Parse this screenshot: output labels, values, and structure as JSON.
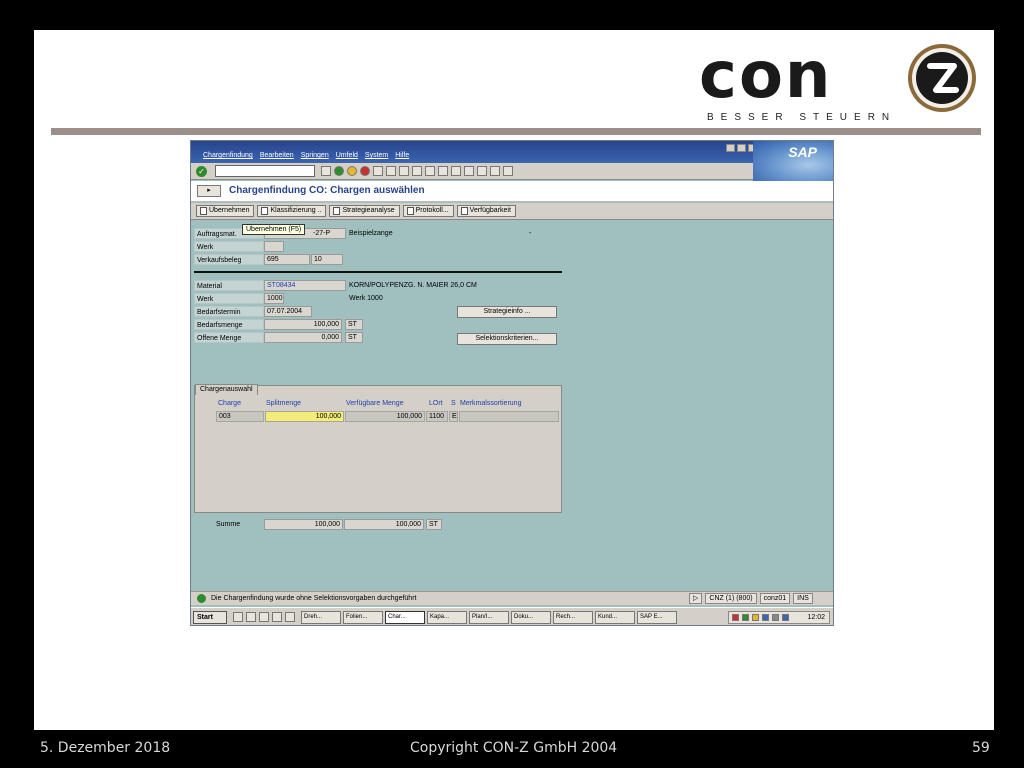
{
  "logo": {
    "word": "con",
    "tagline": "BESSER STEUERN"
  },
  "footer": {
    "date": "5. Dezember 2018",
    "copyright": "Copyright CON-Z GmbH 2004",
    "page": "59"
  },
  "sap": {
    "logo_text": "SAP",
    "menu": [
      "Chargenfindung",
      "Bearbeiten",
      "Springen",
      "Umfeld",
      "System",
      "Hilfe"
    ],
    "screen_title": "Chargenfindung CO: Chargen auswählen",
    "app_buttons": [
      "Übernehmen",
      "Klassifizierung ..",
      "Strategieanalyse",
      "Protokoll...",
      "Verfügbarkeit"
    ],
    "tooltip": "Übernehmen   (F5)",
    "header": {
      "auftragsmat_label": "Auftragsmat.",
      "auftragsmat_value": "-27-P",
      "auftragsmat_desc": "Beispielzange",
      "auftragsmat_dash": "-",
      "werk_label": "Werk",
      "werk_value": "",
      "verkaufsbeleg_label": "Verkaufsbeleg",
      "verkaufsbeleg_value": "695",
      "verkaufsbeleg_pos": "10"
    },
    "material": {
      "material_label": "Material",
      "material_value": "ST08434",
      "material_desc": "KORN/POLYPENZG. N. MAIER     26,0 CM",
      "werk_label": "Werk",
      "werk_value": "1000",
      "werk_desc": "Werk 1000",
      "bedarfstermin_label": "Bedarfstermin",
      "bedarfstermin_value": "07.07.2004",
      "bedarfsmenge_label": "Bedarfsmenge",
      "bedarfsmenge_value": "100,000",
      "bedarfsmenge_unit": "ST",
      "offene_label": "Offene Menge",
      "offene_value": "0,000",
      "offene_unit": "ST",
      "strategieinfo_btn": "Strategieinfo ...",
      "selektion_btn": "Selektionskriterien..."
    },
    "group": {
      "tab_label": "Chargenauswahl",
      "columns": [
        "Charge",
        "Splitmenge",
        "Verfügbare Menge",
        "LOrt",
        "S",
        "Merkmalssortierung"
      ],
      "row": {
        "charge": "003",
        "splitmenge": "100,000",
        "verfuegbar": "100,000",
        "lort": "1100",
        "s": "E",
        "merkmal": ""
      }
    },
    "summe": {
      "label": "Summe",
      "split": "100,000",
      "verfuegbar": "100,000",
      "unit": "ST"
    },
    "status": {
      "message": "Die Chargenfindung wurde ohne Selektionsvorgaben durchgeführt",
      "system": "CNZ (1) (800)",
      "user": "conz01",
      "mode": "INS"
    },
    "taskbar": {
      "start": "Start",
      "tasks": [
        "Dreh...",
        "Folien...",
        "Char...",
        "Kapa...",
        "Plan/I...",
        "Doku...",
        "Rech...",
        "Kund...",
        "SAP E..."
      ],
      "clock": "12:02"
    }
  }
}
